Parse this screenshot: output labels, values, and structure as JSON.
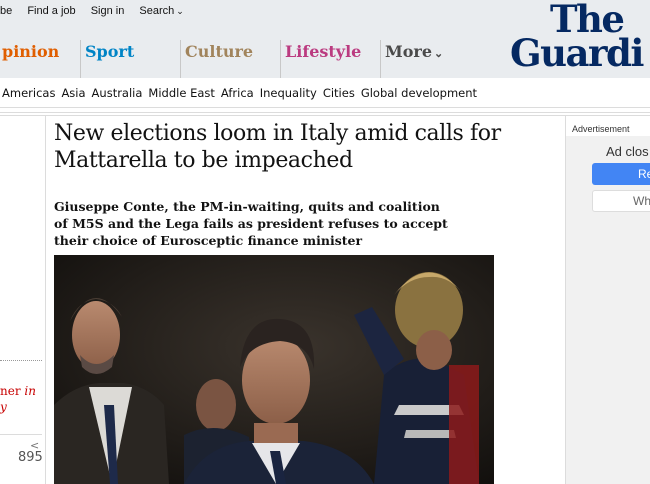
{
  "top_links": {
    "subscribe_fragment": "be",
    "find_a_job": "Find a job",
    "sign_in": "Sign in",
    "search": "Search"
  },
  "pillars": {
    "opinion": "pinion",
    "sport": "Sport",
    "culture": "Culture",
    "lifestyle": "Lifestyle",
    "more": "More"
  },
  "logo": {
    "line1": "The",
    "line2": "Guardi"
  },
  "subnav": [
    "Americas",
    "Asia",
    "Australia",
    "Middle East",
    "Africa",
    "Inequality",
    "Cities",
    "Global development"
  ],
  "left": {
    "byline_prefix": "ner",
    "byline_in": "in",
    "byline_line2": "y",
    "share_count": "895"
  },
  "article": {
    "headline": "New elections loom in Italy amid calls for Mattarella to be impeached",
    "standfirst": "Giuseppe Conte, the PM-in-waiting, quits and coalition of M5S and the Lega fails as president refuses to accept their choice of Eurosceptic finance minister"
  },
  "ad": {
    "label": "Advertisement",
    "close_text": "Ad clos",
    "button1": "Re",
    "button2": "Wh"
  },
  "colors": {
    "opinion": "#e05e00",
    "sport": "#0084c6",
    "culture": "#a1845c",
    "lifestyle": "#bb3b80",
    "brand": "#052962",
    "ad_button": "#4285f4"
  }
}
